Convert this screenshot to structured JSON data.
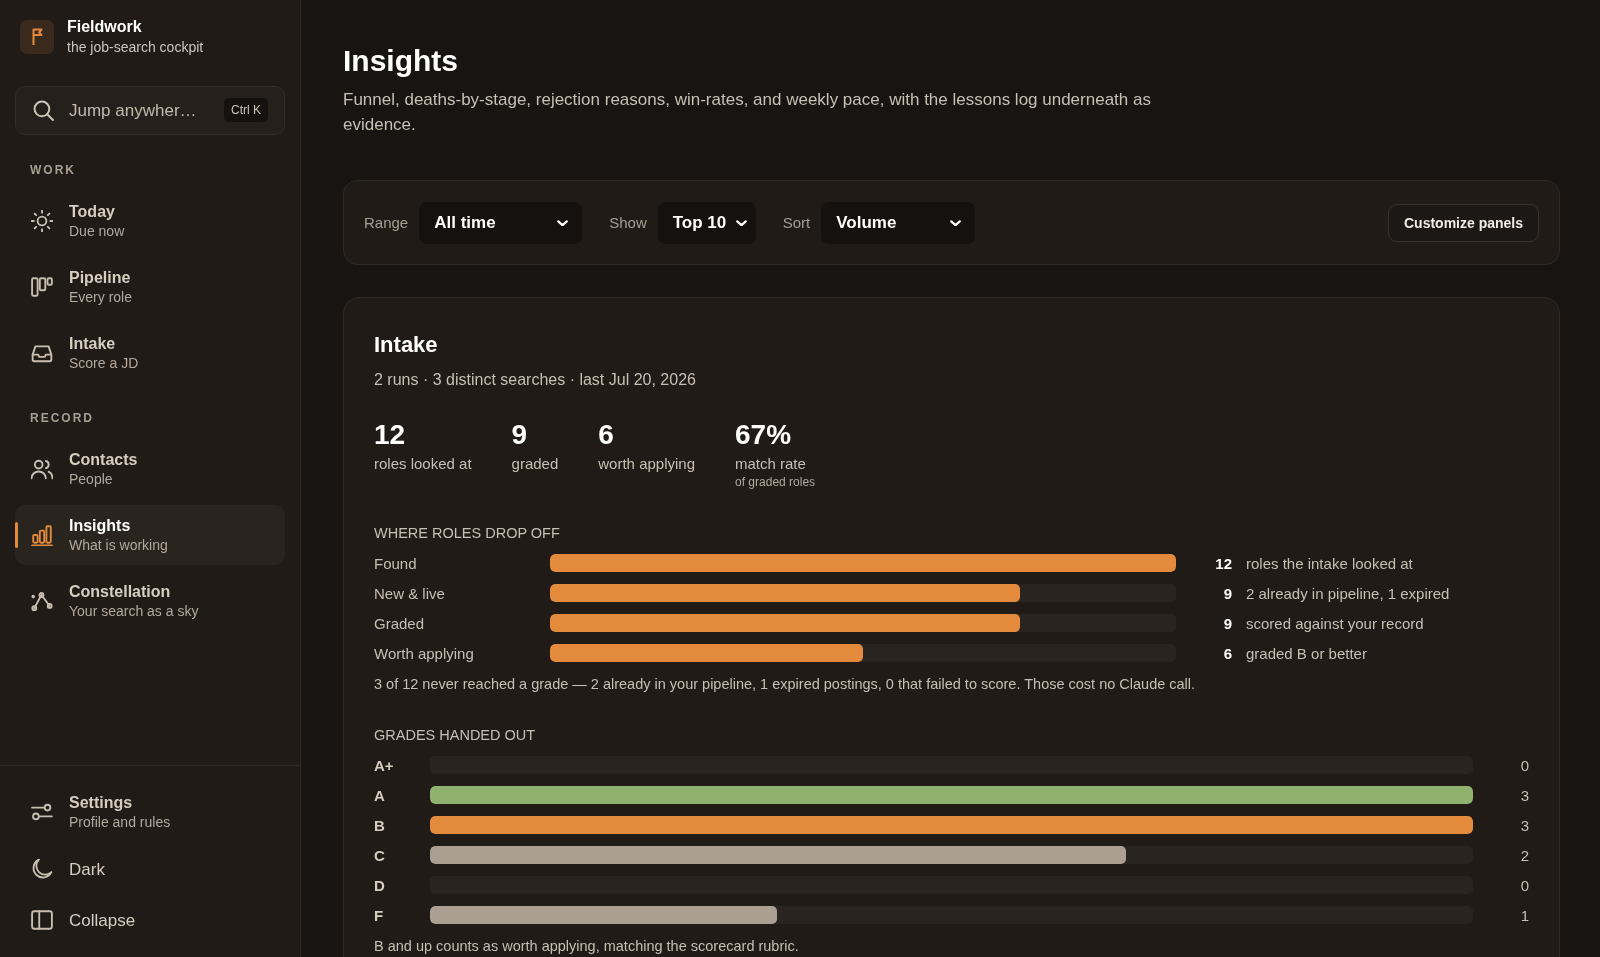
{
  "sidebar": {
    "brand": {
      "title": "Fieldwork",
      "subtitle": "the job-search cockpit"
    },
    "search": {
      "placeholder": "Jump anywher…",
      "shortcut": "Ctrl K"
    },
    "sections": [
      {
        "heading": "WORK",
        "items": [
          {
            "label": "Today",
            "caption": "Due now",
            "selected": false
          },
          {
            "label": "Pipeline",
            "caption": "Every role",
            "selected": false
          },
          {
            "label": "Intake",
            "caption": "Score a JD",
            "selected": false
          }
        ]
      },
      {
        "heading": "RECORD",
        "items": [
          {
            "label": "Contacts",
            "caption": "People",
            "selected": false
          },
          {
            "label": "Insights",
            "caption": "What is working",
            "selected": true
          },
          {
            "label": "Constellation",
            "caption": "Your search as a sky",
            "selected": false
          }
        ]
      }
    ],
    "footer": [
      {
        "label": "Settings",
        "caption": "Profile and rules"
      },
      {
        "label": "Dark"
      },
      {
        "label": "Collapse"
      }
    ]
  },
  "page": {
    "title": "Insights",
    "description": "Funnel, deaths-by-stage, rejection reasons, win-rates, and weekly pace, with the lessons log underneath as evidence."
  },
  "filters": {
    "controls": [
      {
        "label": "Range",
        "value": "All time"
      },
      {
        "label": "Show",
        "value": "Top 10"
      },
      {
        "label": "Sort",
        "value": "Volume"
      }
    ],
    "action": "Customize panels"
  },
  "intake": {
    "title": "Intake",
    "subtitle": "2 runs · 3 distinct searches · last Jul 20, 2026",
    "stats": [
      {
        "value": "12",
        "label": "roles looked at"
      },
      {
        "value": "9",
        "label": "graded"
      },
      {
        "value": "6",
        "label": "worth applying"
      },
      {
        "value": "67%",
        "label": "match rate",
        "note": "of graded roles"
      }
    ],
    "drop_off": {
      "heading": "WHERE ROLES DROP OFF",
      "rows": [
        {
          "label": "Found",
          "level": 1,
          "count": "12",
          "detail": "roles the intake looked at"
        },
        {
          "label": "New & live",
          "level": 0.75,
          "count": "9",
          "detail": "2 already in pipeline, 1 expired"
        },
        {
          "label": "Graded",
          "level": 0.75,
          "count": "9",
          "detail": "scored against your record"
        },
        {
          "label": "Worth applying",
          "level": 0.5,
          "count": "6",
          "detail": "graded B or better"
        }
      ],
      "note": "3 of 12 never reached a grade — 2 already in your pipeline, 1 expired postings, 0 that failed to score. Those cost no Claude call."
    },
    "grades": {
      "heading": "GRADES HANDED OUT",
      "rows": [
        {
          "label": "A+",
          "level": 0,
          "count": "0"
        },
        {
          "label": "A",
          "level": 1,
          "count": "3",
          "color": "#8fb26e"
        },
        {
          "label": "B",
          "level": 1,
          "count": "3",
          "color": "#e48a3c"
        },
        {
          "label": "C",
          "level": 0.667,
          "count": "2",
          "color": "#aa9f90"
        },
        {
          "label": "D",
          "level": 0,
          "count": "0"
        },
        {
          "label": "F",
          "level": 0.333,
          "count": "1",
          "color": "#aa9f90"
        }
      ],
      "note": "B and up counts as worth applying, matching the scorecard rubric."
    }
  }
}
